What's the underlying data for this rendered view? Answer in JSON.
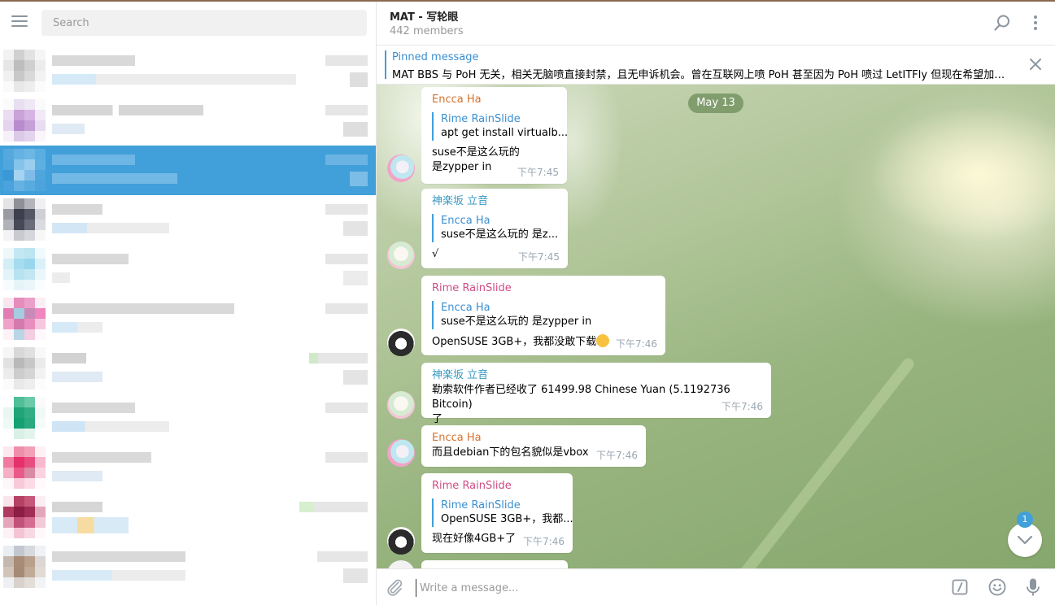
{
  "sidebar": {
    "search_placeholder": "Search"
  },
  "header": {
    "title": "MAT - 写轮眼",
    "subtitle": "442 members"
  },
  "pinned": {
    "label": "Pinned message",
    "text": "MAT BBS 与 PoH 无关，相关无脑喷直接封禁，且无申诉机会。曾在互联网上喷 PoH 甚至因为 PoH 喷过 LetITFly 但现在希望加入 ..."
  },
  "history": {
    "date": "May 13",
    "messages": [
      {
        "sender": "Encca Ha",
        "reply_name": "Rime RainSlide",
        "reply_text": "apt get install virtualb...",
        "text_lines": [
          "suse不是这么玩的",
          "是zypper in"
        ],
        "time": "下午7:45"
      },
      {
        "sender": "神楽坂 立音",
        "reply_name": "Encca Ha",
        "reply_text": "suse不是这么玩的 是z...",
        "text": "√",
        "time": "下午7:45"
      },
      {
        "sender": "Rime RainSlide",
        "reply_name": "Encca Ha",
        "reply_text": "suse不是这么玩的 是zypper in",
        "text": "OpenSUSE 3GB+，我都没敢下载",
        "time": "下午7:46"
      },
      {
        "sender": "神楽坂 立音",
        "text_lines": [
          "勒索软件作者已经收了 61499.98 Chinese Yuan (5.1192736 Bitcoin)",
          "了"
        ],
        "time": "下午7:46"
      },
      {
        "sender": "Encca Ha",
        "text": "而且debian下的包名貌似是vbox",
        "time": "下午7:46"
      },
      {
        "sender": "Rime RainSlide",
        "reply_name": "Rime RainSlide",
        "reply_text": "OpenSUSE 3GB+，我都...",
        "text": "现在好像4GB+了",
        "time": "下午7:46"
      }
    ],
    "unread_count": "1"
  },
  "composer": {
    "placeholder": "Write a message..."
  },
  "colors": {
    "accent": "#419fd9",
    "sender_orange": "#d6722c",
    "sender_teal": "#3a98c0",
    "sender_pink": "#ce4c84"
  }
}
